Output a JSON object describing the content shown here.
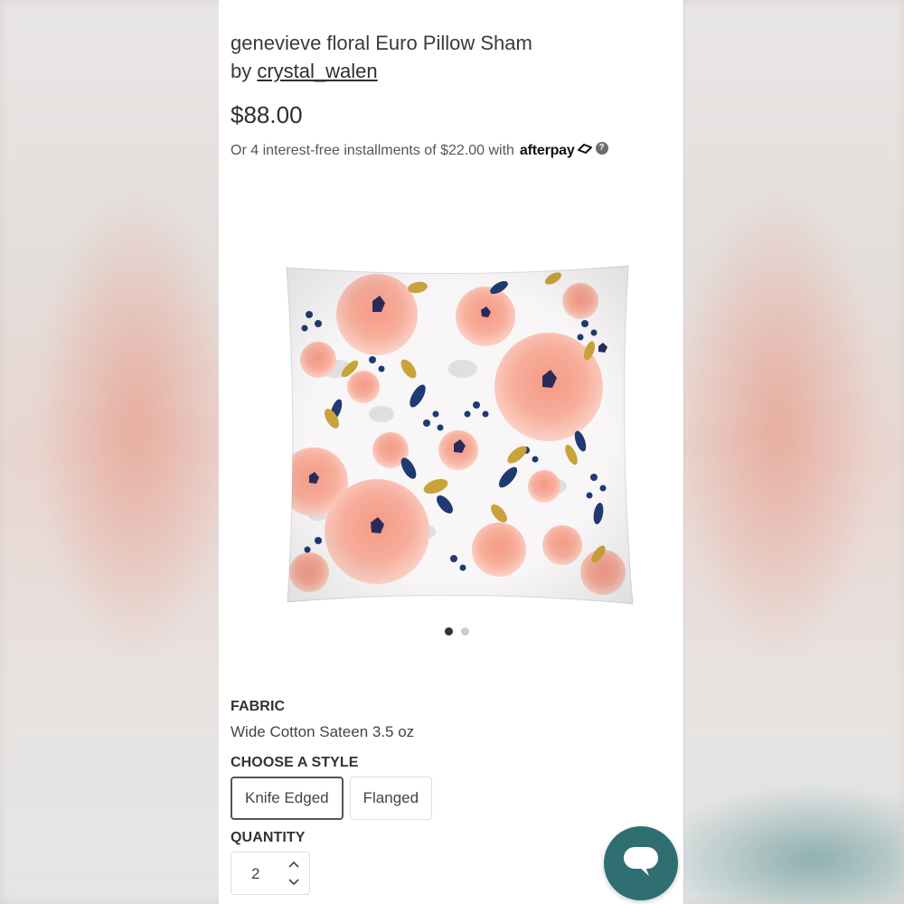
{
  "product": {
    "title": "genevieve floral Euro Pillow Sham",
    "by_prefix": "by ",
    "author": "crystal_walen",
    "price": "$88.00",
    "installments_text": "Or 4 interest-free installments of $22.00 with",
    "afterpay_brand": "afterpay",
    "help_glyph": "?"
  },
  "gallery": {
    "image_alt": "genevieve floral Euro Pillow Sham",
    "slide_count": 2,
    "active_slide": 1
  },
  "fabric": {
    "label": "FABRIC",
    "value": "Wide Cotton Sateen 3.5 oz"
  },
  "style": {
    "label": "CHOOSE A STYLE",
    "options": [
      "Knife Edged",
      "Flanged"
    ],
    "selected": "Knife Edged"
  },
  "quantity": {
    "label": "QUANTITY",
    "value": "2"
  },
  "colors": {
    "chat_button": "#2f6f72",
    "pattern_coral": "#f2a08e",
    "pattern_navy": "#1f3a72",
    "pattern_mustard": "#c9a33a"
  },
  "icons": {
    "afterpay": "afterpay-icon",
    "help": "help-icon",
    "quantity_up": "chevron-up-icon",
    "quantity_down": "chevron-down-icon",
    "chat": "chat-icon"
  }
}
